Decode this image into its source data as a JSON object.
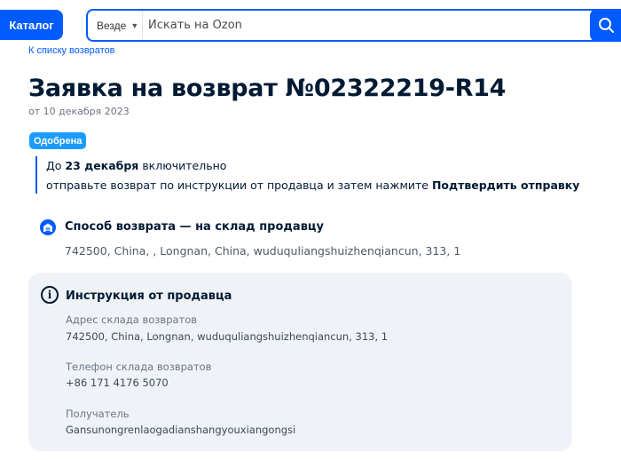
{
  "header": {
    "catalog_label": "Каталог",
    "search_scope": "Везде",
    "search_placeholder": "Искать на Ozon"
  },
  "breadcrumb": {
    "back_label": "К списку возвратов"
  },
  "request": {
    "title": "Заявка на возврат №02322219-R14",
    "date": "от 10 декабря 2023",
    "status": "Одобрена"
  },
  "notice": {
    "line1_prefix": "До ",
    "deadline": "23 декабря",
    "line1_suffix": " включительно",
    "line2_prefix": "отправьте возврат по инструкции от продавца и затем нажмите ",
    "confirm_action": "Подтвердить отправку"
  },
  "return_method": {
    "title": "Способ возврата — на склад продавцу",
    "address": "742500, China, , Longnan, China, wuduquliangshuizhenqiancun, 313, 1"
  },
  "seller_instructions": {
    "title": "Инструкция от продавца",
    "fields": [
      {
        "label": "Адрес склада возвратов",
        "value": "742500, China, Longnan, wuduquliangshuizhenqiancun, 313, 1"
      },
      {
        "label": "Телефон склада возвратов",
        "value": "+86 171 4176 5070"
      },
      {
        "label": "Получатель",
        "value": "Gansunongrenlaogadianshangyouxiangongsi"
      }
    ]
  },
  "colors": {
    "brand_blue": "#005bff",
    "badge_blue": "#1a9cff",
    "card_bg": "#eff2f6",
    "text_dark": "#001a34"
  },
  "icons": {
    "search": "search-icon",
    "warehouse": "warehouse-icon",
    "info": "info-icon",
    "chevron": "chevron-down-icon"
  }
}
